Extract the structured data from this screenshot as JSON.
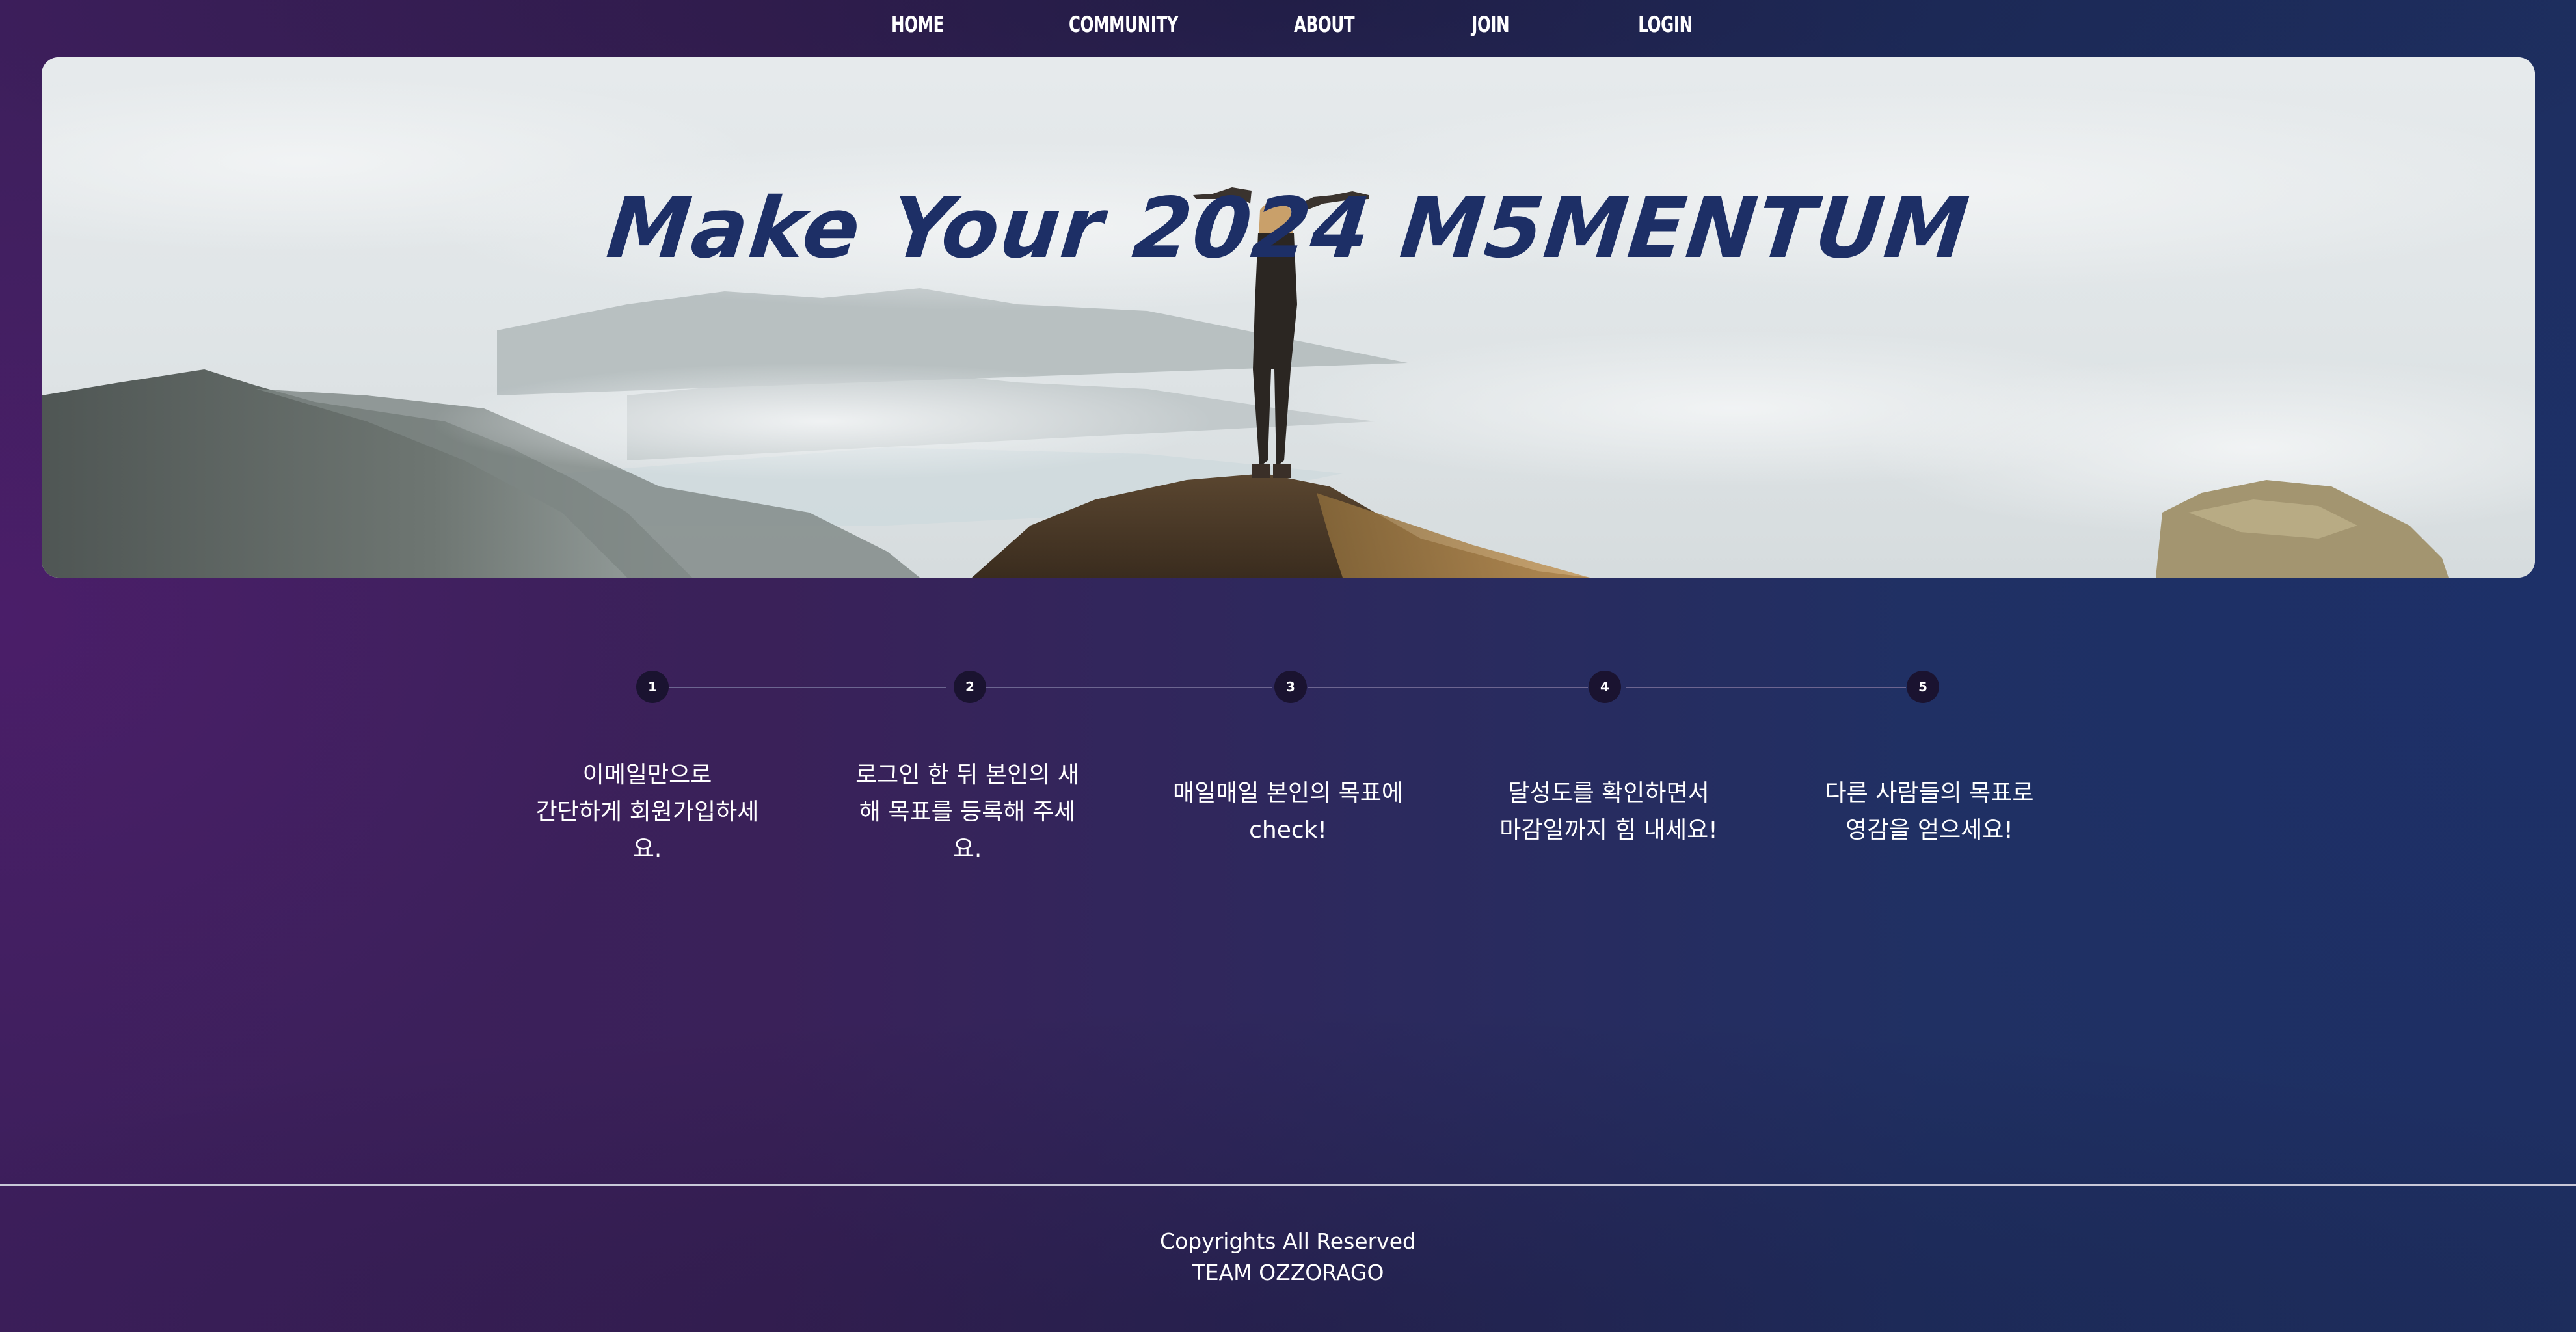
{
  "nav": {
    "home": "HOME",
    "community": "COMMUNITY",
    "about": "ABOUT",
    "join": "JOIN",
    "login": "LOGIN"
  },
  "hero": {
    "title": "Make Your 2024 M5MENTUM"
  },
  "steps": [
    {
      "number": "1",
      "text": "이메일만으로\n간단하게 회원가입하세\n요."
    },
    {
      "number": "2",
      "text": "로그인 한 뒤 본인의 새\n해 목표를 등록해 주세\n요."
    },
    {
      "number": "3",
      "text": "매일매일 본인의 목표에\ncheck!"
    },
    {
      "number": "4",
      "text": "달성도를 확인하면서\n마감일까지 힘 내세요!"
    },
    {
      "number": "5",
      "text": "다른 사람들의 목표로\n영감을 얻으세요!"
    }
  ],
  "footer": {
    "line1": "Copyrights All Reserved",
    "line2": "TEAM OZZORAGO"
  },
  "colors": {
    "title": "#1d2f66",
    "step_dot": "#1a1330",
    "background_left": "#3e1f5d",
    "background_right": "#1e2f60"
  }
}
